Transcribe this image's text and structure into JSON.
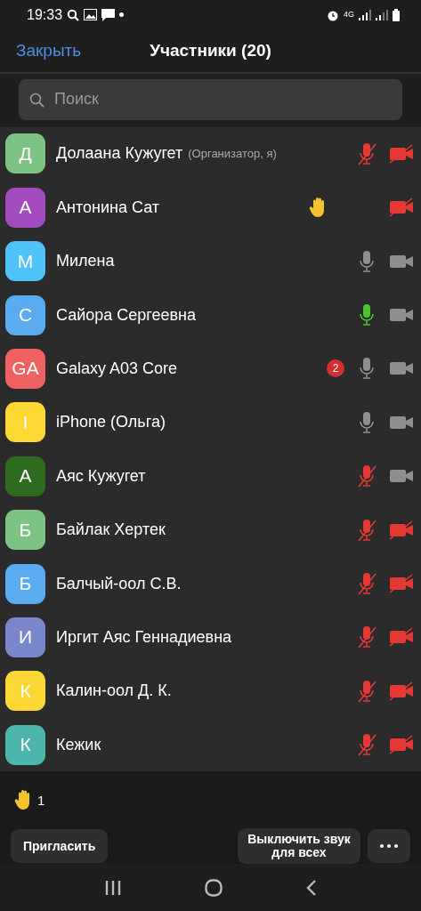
{
  "status_bar": {
    "time": "19:33",
    "network": "4G"
  },
  "header": {
    "close": "Закрыть",
    "title": "Участники (20)"
  },
  "search": {
    "placeholder": "Поиск"
  },
  "participants": [
    {
      "initials": "Д",
      "name": "Долаана Кужугет",
      "note": "(Организатор, я)",
      "color": "#7dc383",
      "hand": false,
      "mic": {
        "muted": true,
        "talking": false
      },
      "video_on": false
    },
    {
      "initials": "А",
      "name": "Антонина Сат",
      "color": "#a24bbf",
      "hand": true,
      "video_on": false
    },
    {
      "initials": "М",
      "name": "Милена",
      "color": "#4fc3f7",
      "hand": false,
      "mic": {
        "muted": false,
        "talking": false
      },
      "video_on": true
    },
    {
      "initials": "С",
      "name": "Сайора Сергеевна",
      "color": "#5aabf0",
      "hand": false,
      "mic": {
        "muted": false,
        "talking": true
      },
      "video_on": true
    },
    {
      "initials": "GA",
      "name": "Galaxy A03 Core",
      "color": "#f06262",
      "hand": false,
      "badge": "2",
      "mic": {
        "muted": false,
        "talking": false
      },
      "video_on": true
    },
    {
      "initials": "I",
      "name": "iPhone (Ольга)",
      "color": "#fdd835",
      "hand": false,
      "mic": {
        "muted": false,
        "talking": false
      },
      "video_on": true
    },
    {
      "initials": "А",
      "name": "Аяс Кужугет",
      "color": "#2e6b1f",
      "hand": false,
      "mic": {
        "muted": true,
        "talking": false
      },
      "video_on": true
    },
    {
      "initials": "Б",
      "name": "Байлак Хертек",
      "color": "#7dc383",
      "hand": false,
      "mic": {
        "muted": true,
        "talking": false
      },
      "video_on": false
    },
    {
      "initials": "Б",
      "name": "Балчый-оол С.В.",
      "color": "#5aabf0",
      "hand": false,
      "mic": {
        "muted": true,
        "talking": false
      },
      "video_on": false
    },
    {
      "initials": "И",
      "name": "Иргит Аяс Геннадиевна",
      "color": "#7986cb",
      "hand": false,
      "mic": {
        "muted": true,
        "talking": false
      },
      "video_on": false
    },
    {
      "initials": "К",
      "name": "Калин-оол Д. К.",
      "color": "#fdd835",
      "hand": false,
      "mic": {
        "muted": true,
        "talking": false
      },
      "video_on": false
    },
    {
      "initials": "К",
      "name": "Кежик",
      "color": "#4db6ac",
      "hand": false,
      "mic": {
        "muted": true,
        "talking": false
      },
      "video_on": false
    }
  ],
  "raised_hands": {
    "count": "1"
  },
  "buttons": {
    "invite": "Пригласить",
    "mute_all": "Выключить звук для всех"
  }
}
